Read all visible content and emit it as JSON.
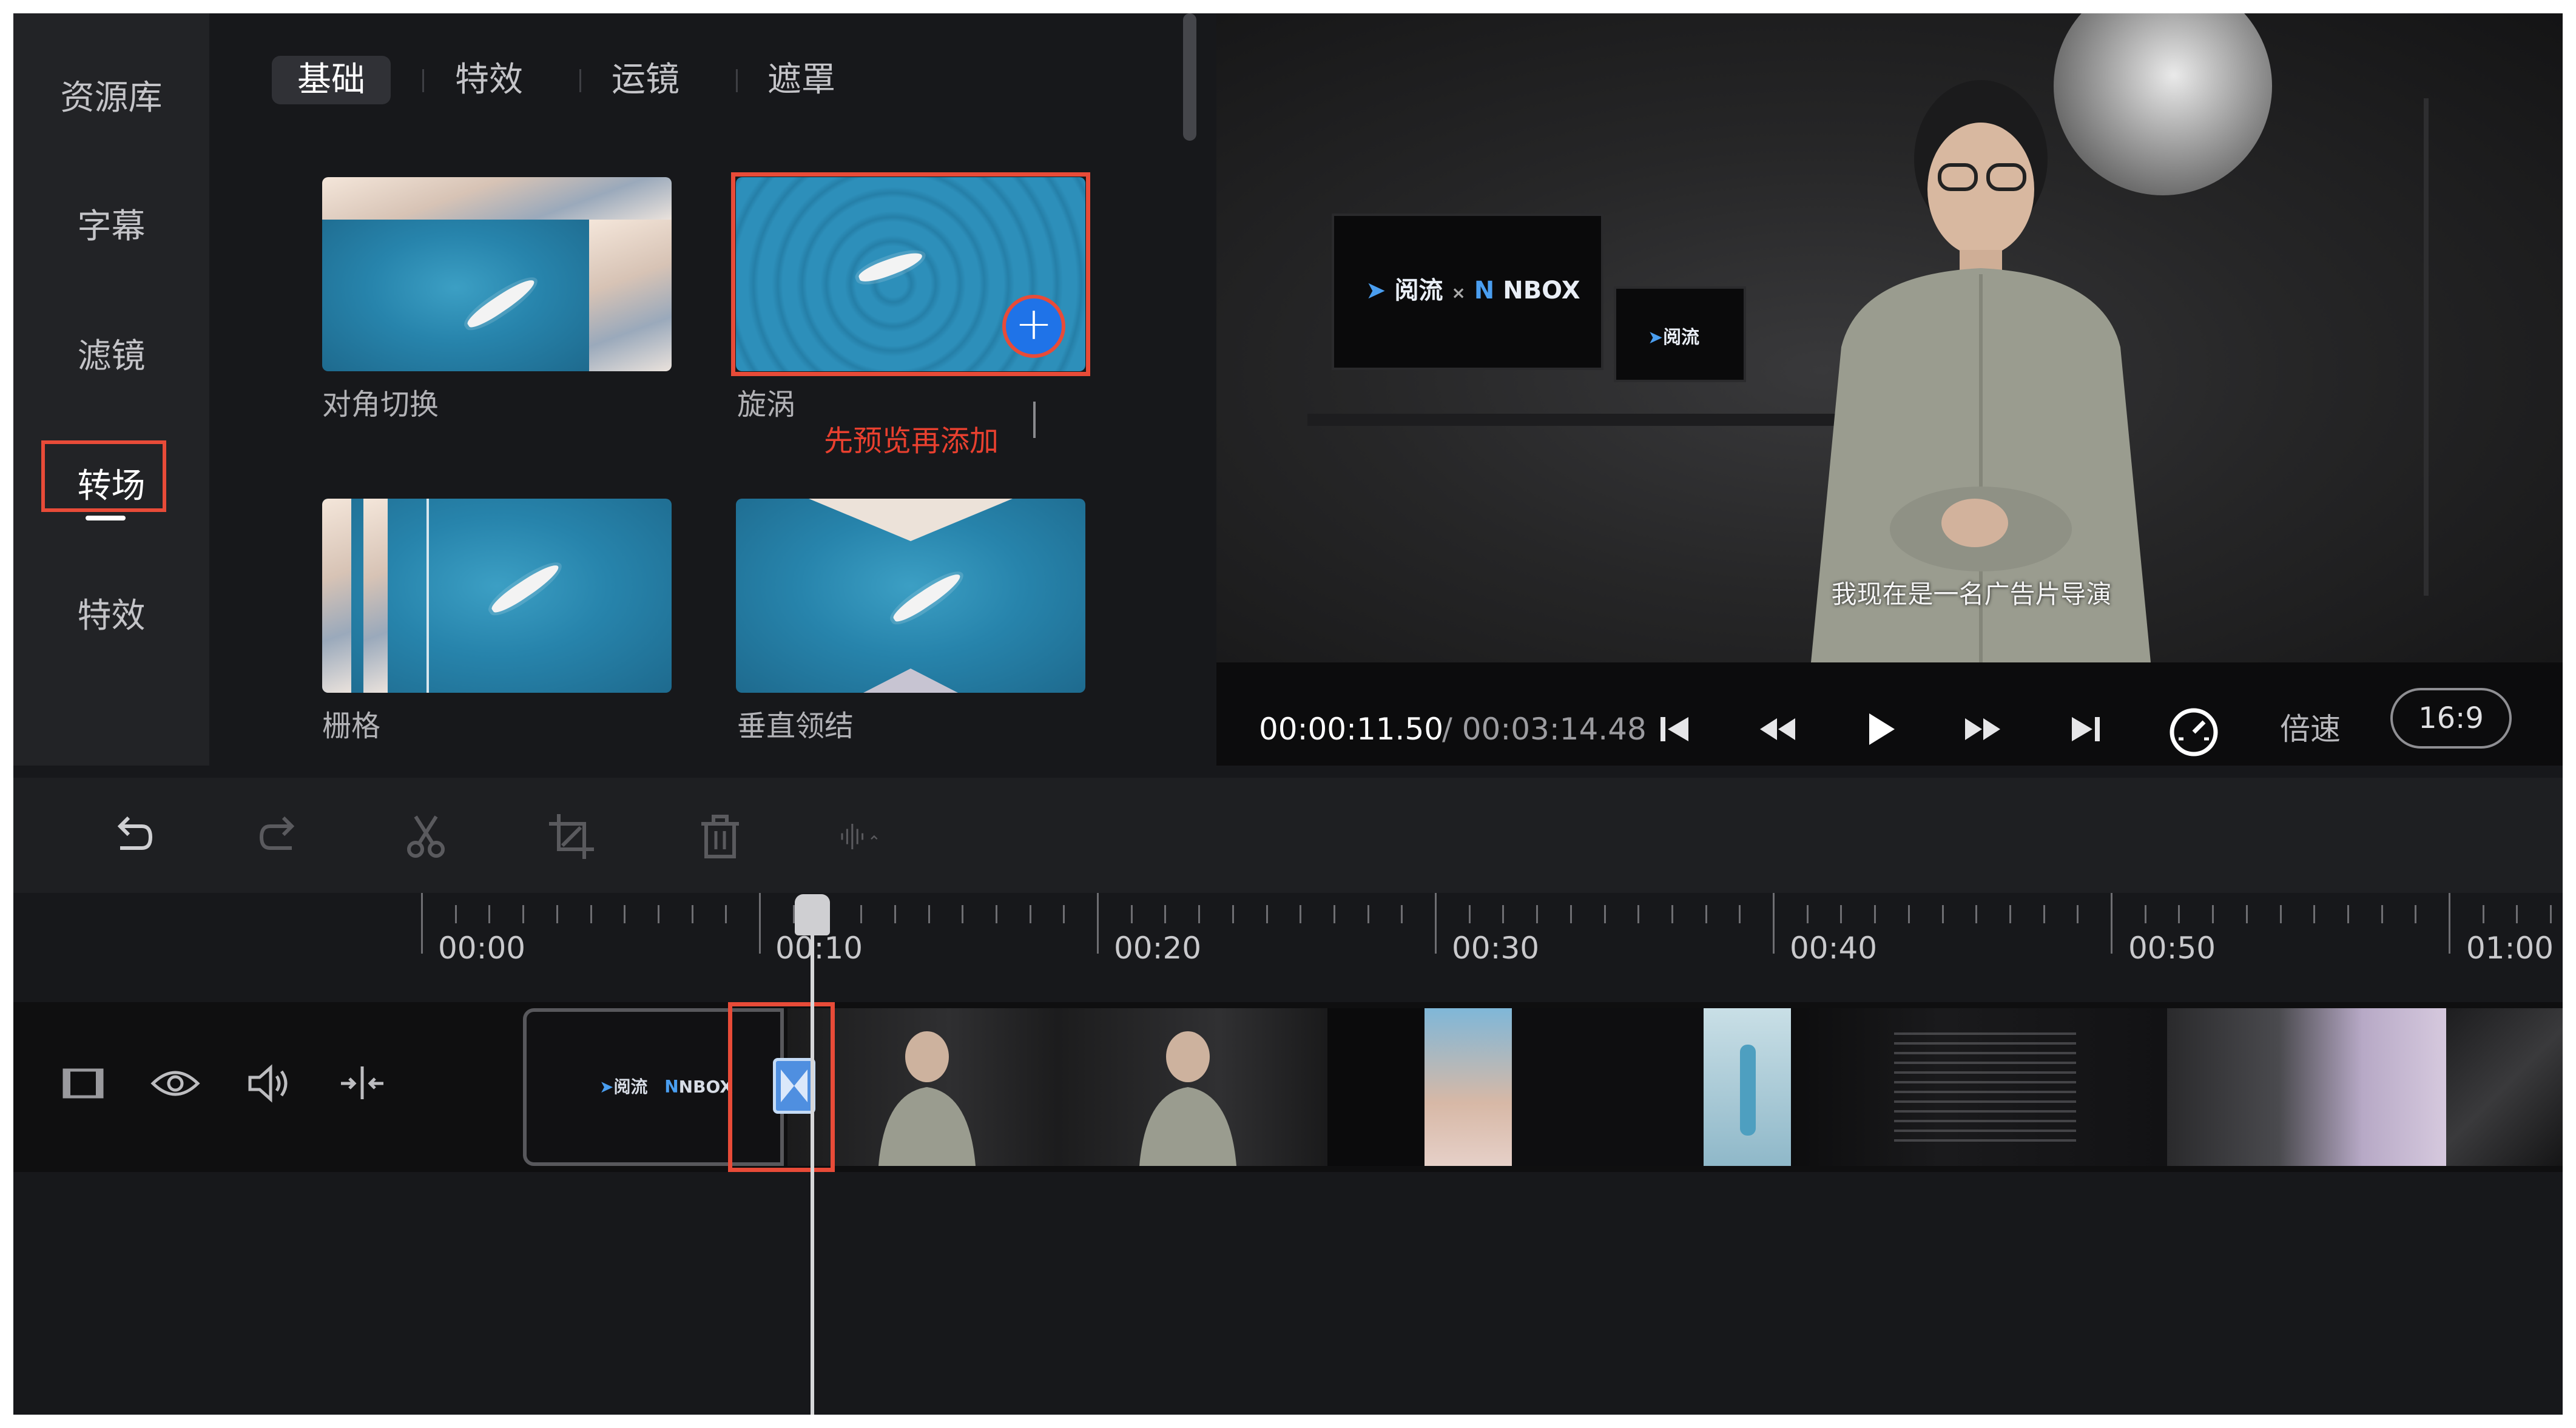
{
  "sidebar": {
    "items": [
      {
        "label": "资源库"
      },
      {
        "label": "字幕"
      },
      {
        "label": "滤镜"
      },
      {
        "label": "转场"
      },
      {
        "label": "特效"
      }
    ]
  },
  "panel": {
    "tabs": [
      {
        "label": "基础"
      },
      {
        "label": "特效"
      },
      {
        "label": "运镜"
      },
      {
        "label": "遮罩"
      }
    ],
    "transitions": [
      {
        "name": "对角切换"
      },
      {
        "name": "旋涡"
      },
      {
        "name": "栅格"
      },
      {
        "name": "垂直领结"
      }
    ],
    "annotation": "先预览再添加"
  },
  "preview": {
    "logo_text": "阅流",
    "logo_separator": "×",
    "partner_logo": "NBOX",
    "small_logo": "阅流",
    "subtitle": "我现在是一名广告片导演",
    "current_time": "00:00:11.50",
    "total_time": "/ 00:03:14.48",
    "speed_label": "倍速",
    "ratio": "16:9"
  },
  "toolbar": {
    "icons": [
      "undo-icon",
      "redo-icon",
      "scissors-icon",
      "crop-icon",
      "trash-icon",
      "audio-split-icon"
    ]
  },
  "timeline": {
    "labels": [
      "00:00",
      "00:10",
      "00:20",
      "00:30",
      "00:40",
      "00:50",
      "01:00"
    ],
    "clip_logo": "阅流",
    "clip_partner": "NBOX"
  },
  "colors": {
    "accent_red": "#e84b38",
    "add_blue": "#1f73e8",
    "transition_blue": "#4f8fe0"
  }
}
